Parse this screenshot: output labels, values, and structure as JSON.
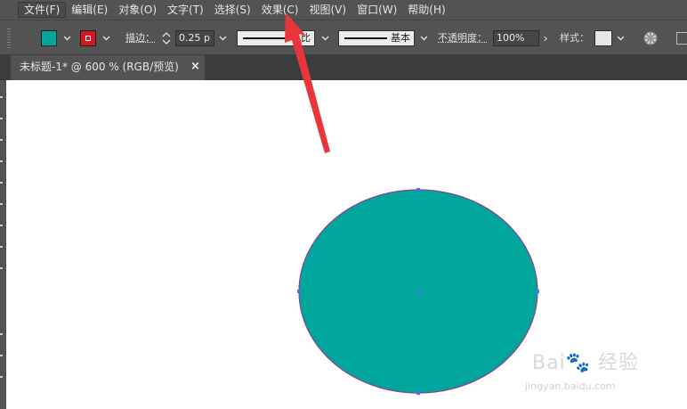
{
  "menu": {
    "items": [
      {
        "label": "文件(F)"
      },
      {
        "label": "编辑(E)"
      },
      {
        "label": "对象(O)"
      },
      {
        "label": "文字(T)"
      },
      {
        "label": "选择(S)"
      },
      {
        "label": "效果(C)"
      },
      {
        "label": "视图(V)"
      },
      {
        "label": "窗口(W)"
      },
      {
        "label": "帮助(H)"
      }
    ]
  },
  "control": {
    "fill_color": "#00a69c",
    "stroke_color": "#d01820",
    "stroke_label": "描边：",
    "stroke_weight": "0.25 p",
    "variable_width_label": "比",
    "brush_label": "基本",
    "opacity_label": "不透明度：",
    "opacity_value": "100%",
    "style_label": "样式："
  },
  "document": {
    "tab_title": "未标题-1* @ 600 % (RGB/预览)",
    "close_glyph": "×"
  },
  "canvas": {
    "shape": "ellipse",
    "shape_fill": "#00a69c",
    "shape_stroke": "#8a3f96",
    "anchor_color": "#3b7be8",
    "background": "#ffffff"
  },
  "annotation": {
    "arrow_color": "#e8353c"
  },
  "watermark": {
    "logo_text": "Bai🐾 经验",
    "url": "jingyan.baidu.com"
  },
  "icons": {
    "dropdown": "chevron-down-icon",
    "stepper": "stepper-arrows-icon",
    "recolor": "recolor-globe-icon",
    "close": "close-icon"
  }
}
